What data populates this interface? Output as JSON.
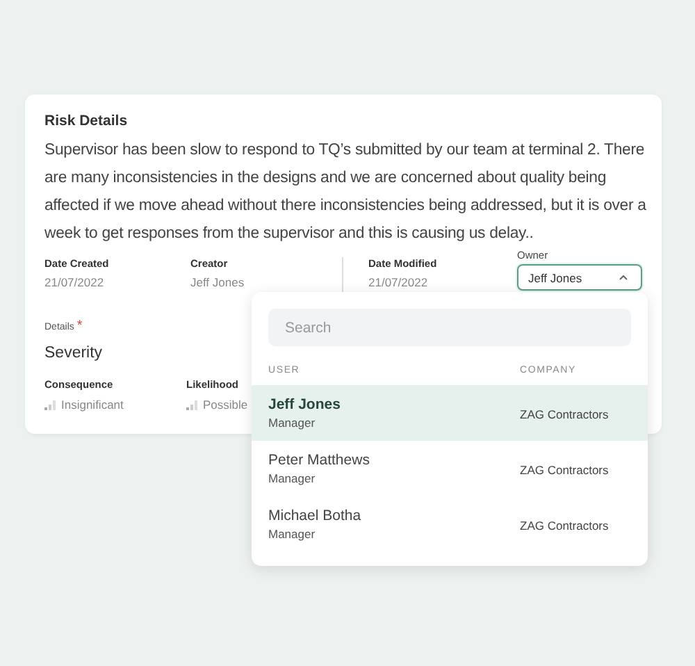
{
  "card": {
    "title": "Risk Details",
    "description": "Supervisor has been slow to respond to TQ’s submitted by our team at terminal 2. There are many inconsistencies in the designs and we are concerned about quality being affected if we move ahead without there inconsistencies being addressed, but it is over a week to get responses from the supervisor and this is causing us delay..",
    "meta": [
      {
        "label": "Date Created",
        "value": "21/07/2022"
      },
      {
        "label": "Creator",
        "value": "Jeff Jones"
      },
      {
        "label": "Date Modified",
        "value": "21/07/2022"
      }
    ],
    "owner": {
      "label": "Owner",
      "value": "Jeff Jones",
      "expanded": true
    },
    "details_label": "Details",
    "required_mark": "*",
    "severity": {
      "title": "Severity",
      "fields": [
        {
          "label": "Consequence",
          "value": "Insignificant"
        },
        {
          "label": "Likelihood",
          "value": "Possible"
        }
      ]
    }
  },
  "dropdown": {
    "search": {
      "placeholder": "Search"
    },
    "columns": [
      "USER",
      "COMPANY"
    ],
    "rows": [
      {
        "name": "Jeff Jones",
        "role": "Manager",
        "company": "ZAG Contractors",
        "selected": true
      },
      {
        "name": "Peter Matthews",
        "role": "Manager",
        "company": "ZAG Contractors",
        "selected": false
      },
      {
        "name": "Michael Botha",
        "role": "Manager",
        "company": "ZAG Contractors",
        "selected": false
      }
    ]
  }
}
